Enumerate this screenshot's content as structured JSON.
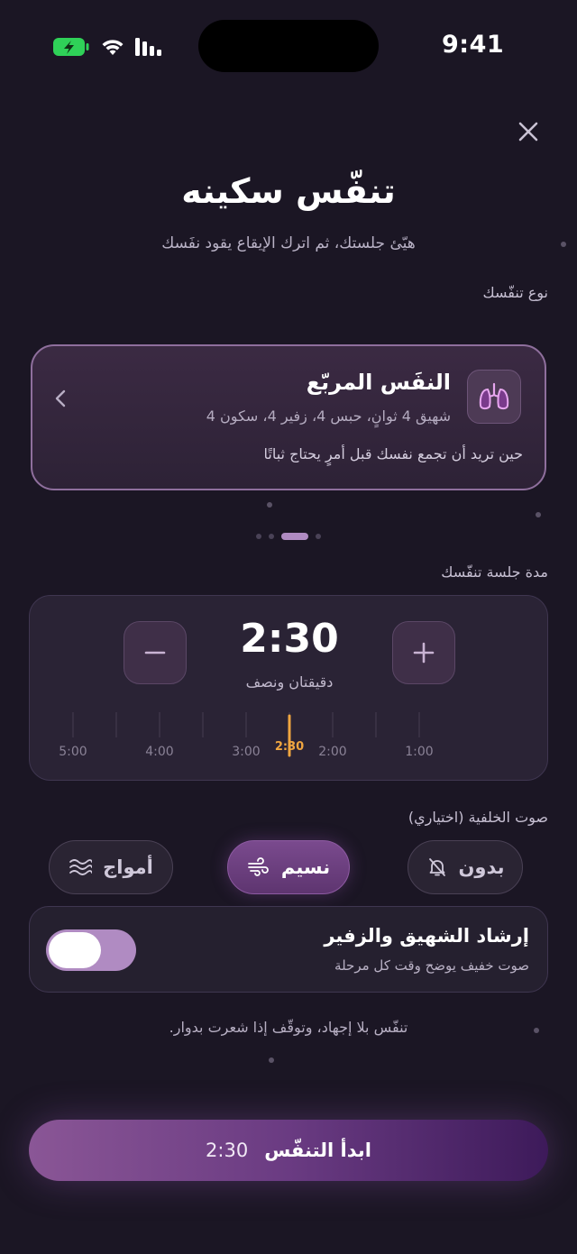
{
  "status": {
    "time": "9:41"
  },
  "header": {
    "title": "تنفّس سكينه",
    "subtitle": "هيّئ جلستك، ثم اترك الإيقاع يقود نفَسك"
  },
  "breath_type": {
    "section_label": "نوع تنفّسك",
    "name": "النفَس المربّع",
    "pattern": "شهيق 4 ثوانٍ، حبس 4، زفير 4، سكون 4",
    "hint": "حين تريد أن تجمع نفسك قبل أمرٍ يحتاج ثباتًا",
    "pager_total": 4,
    "pager_active": 2
  },
  "duration": {
    "section_label": "مدة جلسة تنفّسك",
    "value": "2:30",
    "words": "دقيقتان ونصف",
    "ruler_labels": [
      "5:00",
      "4:00",
      "3:00",
      "2:00",
      "1:00"
    ],
    "marker_label": "2:30"
  },
  "sound": {
    "section_label": "صوت الخلفية (اختياري)",
    "options": [
      {
        "label": "بدون",
        "icon": "bell-off-icon",
        "selected": false
      },
      {
        "label": "نسيم",
        "icon": "wind-icon",
        "selected": true
      },
      {
        "label": "أمواج",
        "icon": "waves-icon",
        "selected": false
      }
    ]
  },
  "guide": {
    "title": "إرشاد الشهيق والزفير",
    "description": "صوت خفيف يوضح وقت كل مرحلة",
    "enabled": true
  },
  "footnote": "تنفّس بلا إجهاد، وتوقّف إذا شعرت بدوار.",
  "start": {
    "label": "ابدأ التنفّس",
    "time": "2:30"
  },
  "colors": {
    "background": "#1b1624",
    "accent": "#b08bc2",
    "marker": "#f0a640",
    "card_border": "#8f6f9d"
  }
}
